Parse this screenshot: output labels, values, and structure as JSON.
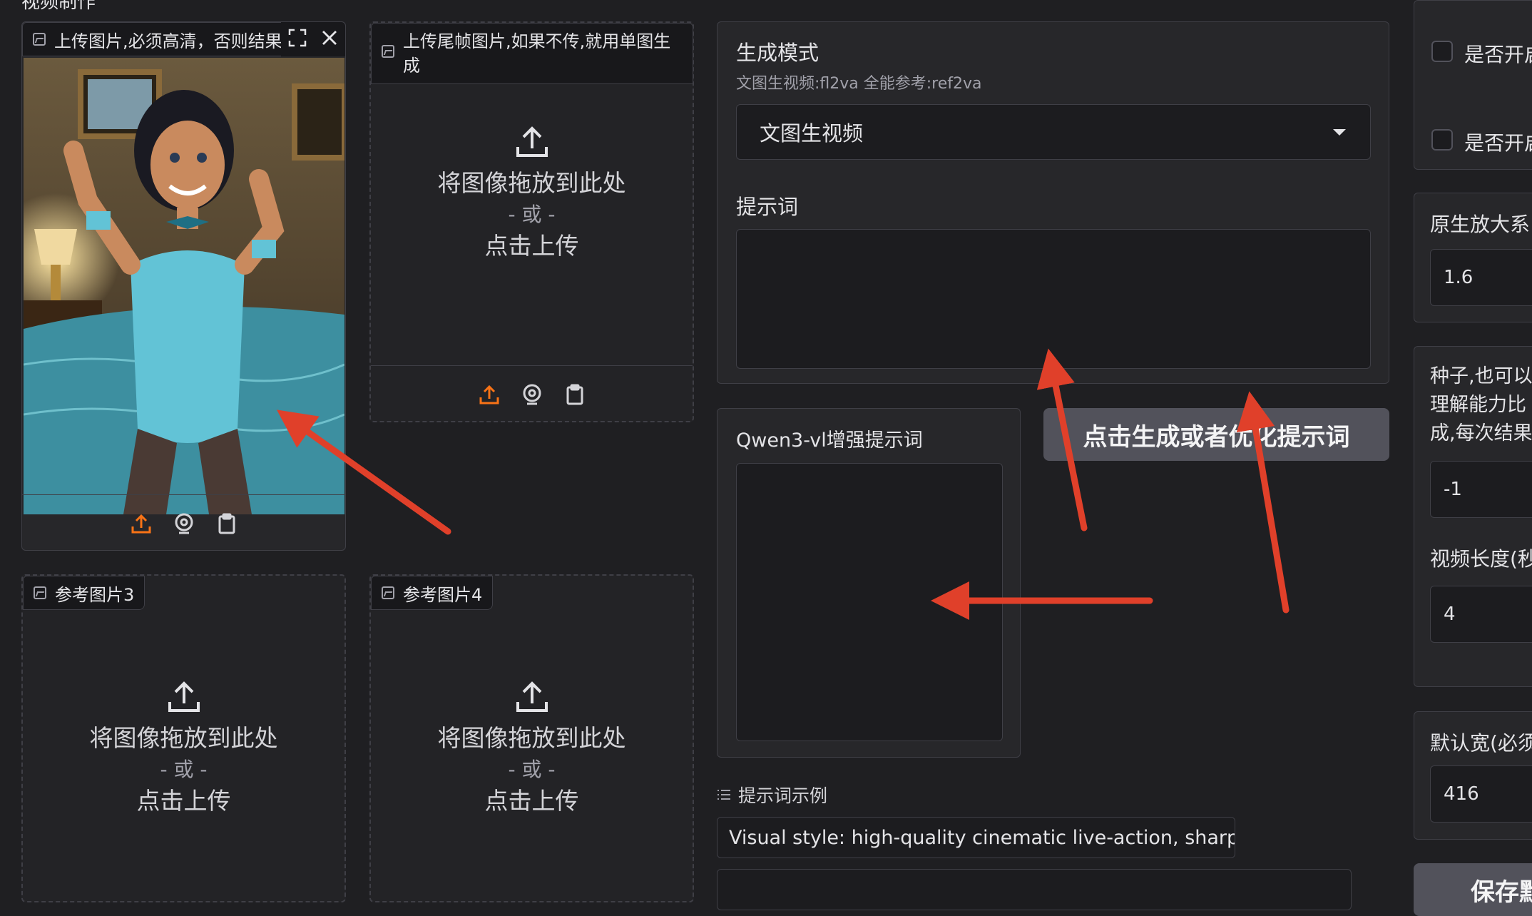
{
  "top_title": "视频制作",
  "upload_main": {
    "label": "上传图片,必须高清，否则结果",
    "fullscreen_icon": "fullscreen-icon",
    "close_icon": "close-icon"
  },
  "upload_tail": {
    "label_line1": "上传尾帧图片,如果不传,就用单图生",
    "label_line2": "成",
    "drop_text": "将图像拖放到此处",
    "or_text": "- 或 -",
    "click_text": "点击上传"
  },
  "ref3": {
    "label": "参考图片3",
    "drop_text": "将图像拖放到此处",
    "or_text": "- 或 -",
    "click_text": "点击上传"
  },
  "ref4": {
    "label": "参考图片4",
    "drop_text": "将图像拖放到此处",
    "or_text": "- 或 -",
    "click_text": "点击上传"
  },
  "mode": {
    "title": "生成模式",
    "hint": "文图生视频:fl2va 全能参考:ref2va",
    "selected": "文图生视频"
  },
  "prompt": {
    "label": "提示词",
    "value": ""
  },
  "qwen": {
    "label": "Qwen3-vl增强提示词",
    "value": ""
  },
  "generate_button": "点击生成或者优化提示词",
  "examples": {
    "header": "提示词示例",
    "item1": "Visual style: high-quality cinematic live-action, sharp focu..."
  },
  "right": {
    "toggle1": "是否开启",
    "toggle2": "是否开启",
    "scale_label": "原生放大系",
    "scale_value": "1.6",
    "seed_line1": "种子,也可以",
    "seed_line2": "理解能力比",
    "seed_line3": "成,每次结果",
    "seed_value": "-1",
    "length_label": "视频长度(秒",
    "length_value": "4",
    "width_label": "默认宽(必须",
    "width_value": "416",
    "save_label": "保存默"
  },
  "colors": {
    "accent": "#f97316",
    "annotation_arrow": "#e0402a",
    "background": "#1f1f22",
    "panel": "#27272a"
  }
}
